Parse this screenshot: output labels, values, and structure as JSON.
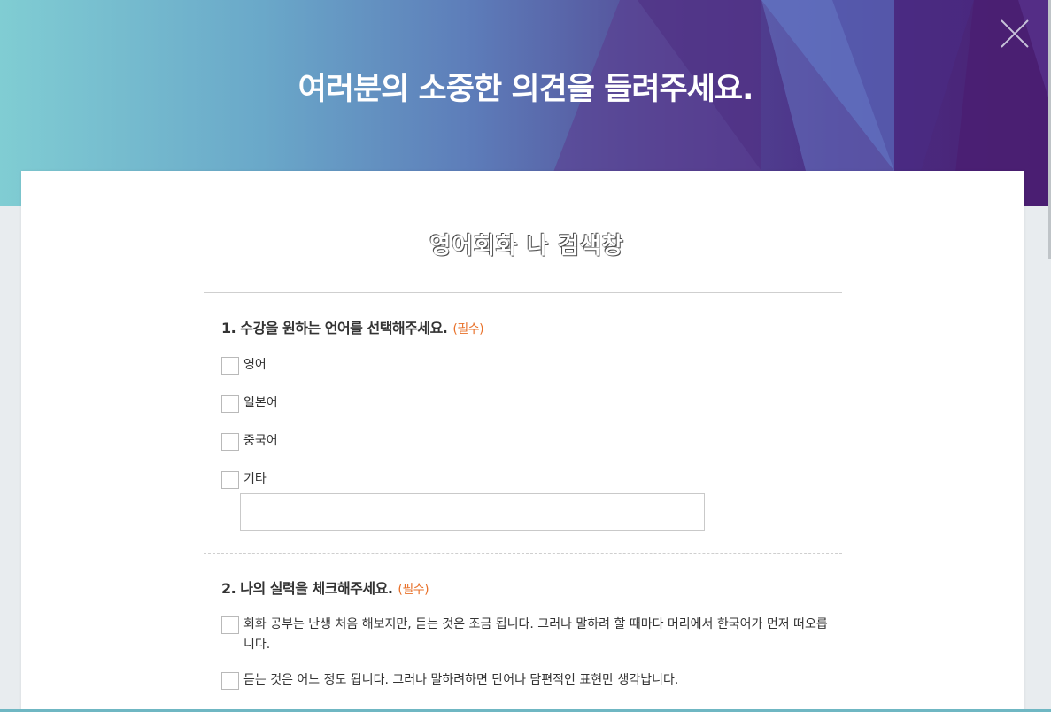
{
  "header": {
    "title": "여러분의 소중한 의견을 들려주세요."
  },
  "brand": {
    "text": "영어회화 나 검색창"
  },
  "questions": [
    {
      "title": "1. 수강을 원하는 언어를 선택해주세요.",
      "required": "(필수)",
      "options": [
        "영어",
        "일본어",
        "중국어",
        "기타"
      ],
      "etc_value": ""
    },
    {
      "title": "2. 나의 실력을 체크해주세요.",
      "required": "(필수)",
      "options": [
        "회화 공부는 난생 처음 해보지만, 듣는 것은 조금 됩니다. 그러나 말하려 할 때마다 머리에서 한국어가 먼저 떠오릅니다.",
        "듣는 것은 어느 정도 됩니다. 그러나 말하려하면 단어나 담편적인 표현만 생각납니다."
      ]
    }
  ],
  "colors": {
    "required": "#e8712a",
    "header_start": "#80cdd3",
    "header_end": "#4a1f70"
  },
  "icons": {
    "close": "close-icon"
  }
}
